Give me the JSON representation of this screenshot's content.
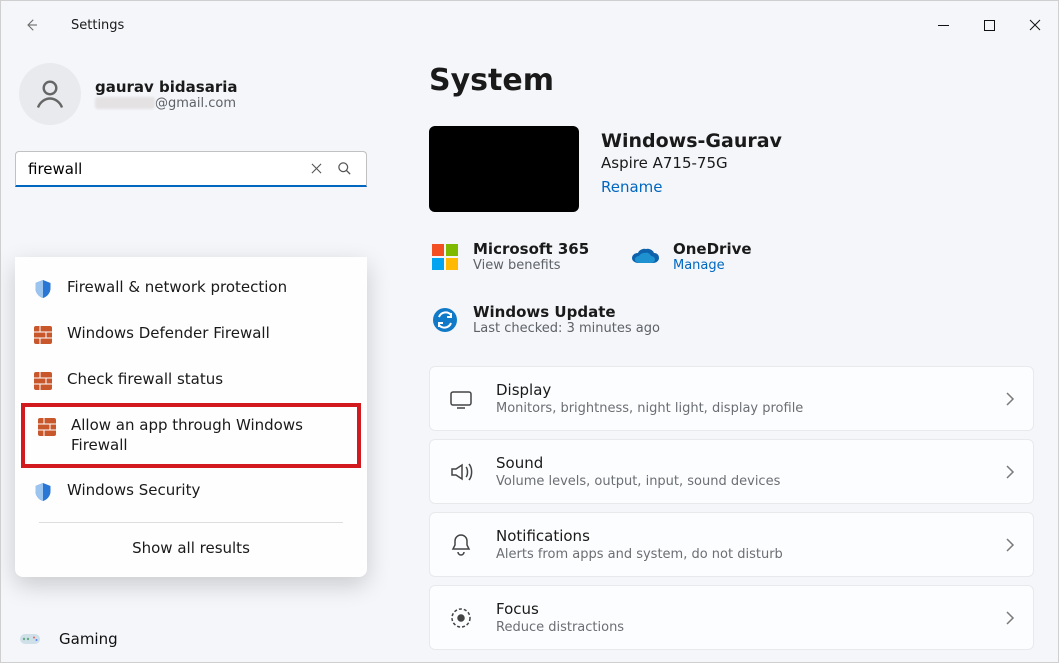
{
  "window": {
    "title": "Settings"
  },
  "profile": {
    "name": "gaurav bidasaria",
    "email_suffix": "@gmail.com"
  },
  "search": {
    "value": "firewall",
    "results": [
      {
        "icon": "shield-blue",
        "label": "Firewall & network protection"
      },
      {
        "icon": "brick-wall",
        "label": "Windows Defender Firewall"
      },
      {
        "icon": "brick-wall",
        "label": "Check firewall status"
      },
      {
        "icon": "brick-wall",
        "label": "Allow an app through Windows Firewall",
        "highlight": true
      },
      {
        "icon": "shield-blue",
        "label": "Windows Security"
      }
    ],
    "show_all": "Show all results"
  },
  "nav_behind": {
    "label": "Gaming"
  },
  "page": {
    "title": "System",
    "device": {
      "name": "Windows-Gaurav",
      "model": "Aspire A715-75G",
      "rename": "Rename"
    },
    "quick": [
      {
        "icon": "ms365",
        "title": "Microsoft 365",
        "sub": "View benefits"
      },
      {
        "icon": "onedrive",
        "title": "OneDrive",
        "sub": "Manage",
        "link": true
      },
      {
        "icon": "sync",
        "title": "Windows Update",
        "sub": "Last checked: 3 minutes ago"
      }
    ],
    "cards": [
      {
        "icon": "display",
        "title": "Display",
        "sub": "Monitors, brightness, night light, display profile"
      },
      {
        "icon": "sound",
        "title": "Sound",
        "sub": "Volume levels, output, input, sound devices"
      },
      {
        "icon": "bell",
        "title": "Notifications",
        "sub": "Alerts from apps and system, do not disturb"
      },
      {
        "icon": "focus",
        "title": "Focus",
        "sub": "Reduce distractions"
      }
    ]
  }
}
